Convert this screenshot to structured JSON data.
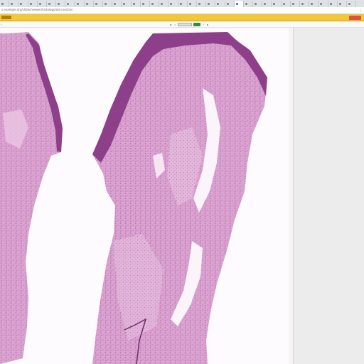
{
  "browser": {
    "tab_count": 38,
    "active_tab_index": 25,
    "url_text": "s.example.org/slides/viewer/histology/skin-section",
    "menu_icon": "kebab-menu-icon"
  },
  "viewer": {
    "title": "",
    "subtitle": "",
    "logo_icon": "brand-logo-icon",
    "header_color": "#f2c838"
  },
  "toolbar": {
    "left_icon": "back-arrow-icon",
    "prev_icon": "chevron-left-icon",
    "next_icon": "chevron-right-icon"
  },
  "slide": {
    "stain_colors": {
      "epidermis": "#8e3f8a",
      "dermis": "#dcaad4",
      "collagen": "#efd0e9",
      "background": "#fdfbfd"
    }
  }
}
